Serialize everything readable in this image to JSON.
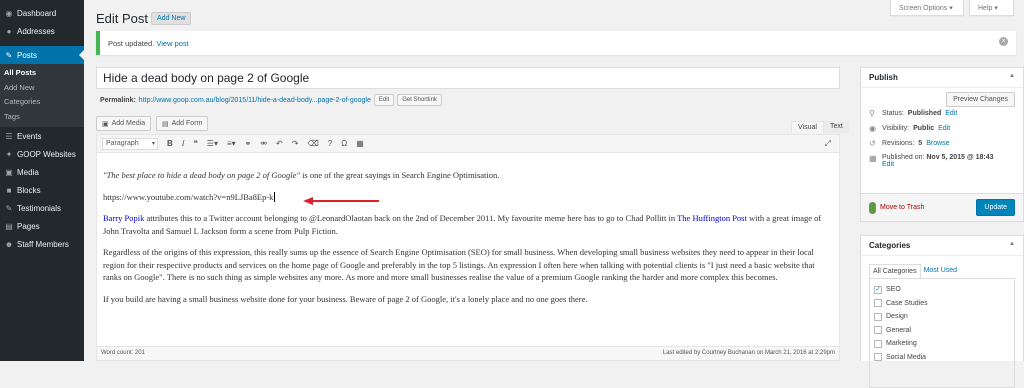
{
  "sidebar": {
    "items": [
      {
        "icon": "◉",
        "label": "Dashboard"
      },
      {
        "icon": "●",
        "label": "Addresses"
      },
      {
        "icon": "✎",
        "label": "Posts"
      },
      {
        "icon": "☰",
        "label": "Events"
      },
      {
        "icon": "✦",
        "label": "GOOP Websites"
      },
      {
        "icon": "▣",
        "label": "Media"
      },
      {
        "icon": "■",
        "label": "Blocks"
      },
      {
        "icon": "✎",
        "label": "Testimonials"
      },
      {
        "icon": "▤",
        "label": "Pages"
      },
      {
        "icon": "☻",
        "label": "Staff Members"
      }
    ],
    "posts_sub": [
      "All Posts",
      "Add New",
      "Categories",
      "Tags"
    ]
  },
  "header": {
    "title": "Edit Post",
    "add_new": "Add New",
    "screen_options": "Screen Options ▾",
    "help": "Help ▾"
  },
  "notice": {
    "text": "Post updated.",
    "link": "View post"
  },
  "post": {
    "title": "Hide a dead body on page 2 of Google",
    "permalink_label": "Permalink:",
    "permalink_url": "http://www.goop.com.au/blog/2015/11/hide-a-dead-body...page-2-of-google",
    "edit": "Edit",
    "shortlink": "Get Shortlink"
  },
  "editor": {
    "add_media": "Add Media",
    "add_form": "Add Form",
    "tab_visual": "Visual",
    "tab_text": "Text",
    "format": "Paragraph",
    "p1_quote": "\"The best place to hide a dead body on page 2 of Google\"",
    "p1_rest": " is one of the great sayings in Search Engine Optimisation.",
    "p2": "https://www.youtube.com/watch?v=n9LJBa8Ep-k",
    "p3_link1": "Barry Popik",
    "p3_a": " attributes this to a Twitter account belonging to @LeonardOlaotan back on the 2nd of December 2011. My favourite meme here has to go to Chad Pollitt in ",
    "p3_link2": "The Huffington Post",
    "p3_b": " with a great image of John Travolta and Samuel L Jackson form a scene from Pulp Fiction.",
    "p4": "Regardless of the origins of this expression,  this really sums up the essence of Search Engine Optimisation (SEO) for small business. When developing small business websites they need to appear in their local region for their respective products and services on the home page of Google and preferably in the top 5 listings. An expression I often here when talking with potential clients is \"I just need a basic website that ranks on Google\". There is no such thing as simple websites any more. As more and more small businesses realise the value of a premium Google ranking the harder and more complex this becomes.",
    "p5": "If you build are having a small business website done for your business. Beware of page 2 of Google, it's a lonely place and no one goes there.",
    "word_count": "Word count: 201",
    "last_edited": "Last edited by Courtney Buchanan on March 21, 2016 at 2:29pm"
  },
  "publish": {
    "title": "Publish",
    "preview": "Preview Changes",
    "status_label": "Status:",
    "status": "Published",
    "visibility_label": "Visibility:",
    "visibility": "Public",
    "revisions_label": "Revisions:",
    "revisions": "5",
    "browse": "Browse",
    "published_label": "Published on:",
    "published": "Nov 5, 2015 @ 18:43",
    "edit": "Edit",
    "trash": "Move to Trash",
    "update": "Update"
  },
  "categories": {
    "title": "Categories",
    "tab_all": "All Categories",
    "tab_used": "Most Used",
    "items": [
      {
        "label": "SEO",
        "checked": "✓"
      },
      {
        "label": "Case Studies",
        "checked": ""
      },
      {
        "label": "Design",
        "checked": ""
      },
      {
        "label": "General",
        "checked": ""
      },
      {
        "label": "Marketing",
        "checked": ""
      },
      {
        "label": "Social Media",
        "checked": ""
      }
    ]
  },
  "colors": {
    "accent": "#0073aa",
    "sidebar": "#23282d",
    "success": "#46b450",
    "trash": "#a00",
    "arrow": "#d9232d"
  }
}
